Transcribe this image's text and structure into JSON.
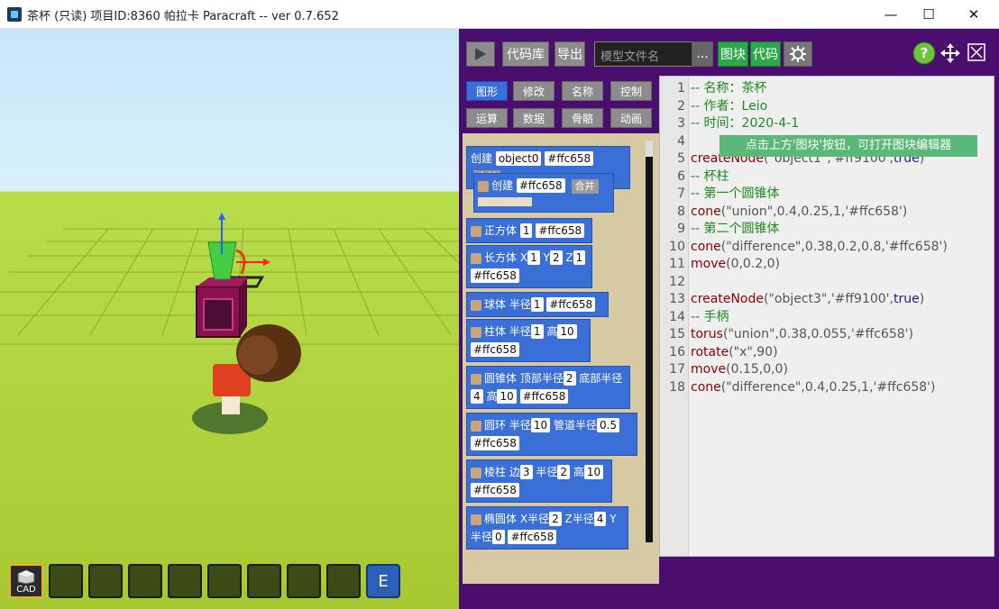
{
  "window": {
    "title": "茶杯 (只读) 项目ID:8360 帕拉卡 Paracraft -- ver 0.7.652",
    "minimize_glyph": "—",
    "maximize_glyph": "☐",
    "close_glyph": "✕"
  },
  "viewport": {
    "hotbar_active_label": "CAD",
    "hotbar_key": "E"
  },
  "toolbar": {
    "code_library_label": "代码库",
    "export_label": "导出",
    "filename_placeholder": "模型文件名",
    "filename_button": "...",
    "blocks_tab_label": "图块",
    "code_tab_label": "代码"
  },
  "categories": [
    {
      "label": "图形",
      "selected": true
    },
    {
      "label": "修改",
      "selected": false
    },
    {
      "label": "名称",
      "selected": false
    },
    {
      "label": "控制",
      "selected": false
    },
    {
      "label": "运算",
      "selected": false
    },
    {
      "label": "数据",
      "selected": false
    },
    {
      "label": "骨骼",
      "selected": false
    },
    {
      "label": "动画",
      "selected": false
    }
  ],
  "blocks": {
    "create": {
      "label": "创建",
      "name": "object0",
      "color": "#ffc658",
      "merge": "合并"
    },
    "sub_create": {
      "label": "创建",
      "color": "#ffc658",
      "merge": "合并"
    },
    "cube": {
      "label": "正方体",
      "size": "1",
      "color": "#ffc658"
    },
    "box": {
      "label": "长方体",
      "x": "X",
      "xv": "1",
      "y": "Y",
      "yv": "2",
      "z": "Z",
      "zv": "1",
      "color": "#ffc658"
    },
    "sphere": {
      "label": "球体",
      "r": "半径",
      "rv": "1",
      "color": "#ffc658"
    },
    "cylinder": {
      "label": "柱体",
      "r": "半径",
      "rv": "1",
      "h": "高",
      "hv": "10",
      "color": "#ffc658"
    },
    "cone": {
      "label": "圆锥体",
      "top": "顶部半径",
      "topv": "2",
      "bottom": "底部半径",
      "bottomv": "4",
      "h": "高",
      "hv": "10",
      "color": "#ffc658"
    },
    "torus": {
      "label": "圆环",
      "r": "半径",
      "rv": "10",
      "tube": "管道半径",
      "tubev": "0.5",
      "color": "#ffc658"
    },
    "prism": {
      "label": "棱柱",
      "edges": "边",
      "edgesv": "3",
      "r": "半径",
      "rv": "2",
      "h": "高",
      "hv": "10",
      "color": "#ffc658"
    },
    "ellipsoid": {
      "label": "椭圆体",
      "xr": "X半径",
      "xrv": "2",
      "zr": "Z半径",
      "zrv": "4",
      "y": "Y",
      "yr": "半径",
      "yrv": "0",
      "color": "#ffc658"
    }
  },
  "editor": {
    "tooltip": "点击上方'图块'按钮，可打开图块编辑器",
    "lines": [
      {
        "n": "1",
        "text": "-- 名称：茶杯"
      },
      {
        "n": "2",
        "text": "-- 作者：Leio"
      },
      {
        "n": "3",
        "text": "-- 时间：2020-4-1"
      },
      {
        "n": "4",
        "text": ""
      },
      {
        "n": "5",
        "fn": "createNode",
        "args": "(\"object1\",'#ff9100',",
        "kw": "true",
        "tail": ")"
      },
      {
        "n": "6",
        "text": "-- 杯柱"
      },
      {
        "n": "7",
        "text": "-- 第一个圆锥体"
      },
      {
        "n": "8",
        "fn": "cone",
        "args": "(\"union\",0.4,0.25,1,'#ffc658')"
      },
      {
        "n": "9",
        "text": "-- 第二个圆锥体"
      },
      {
        "n": "10",
        "fn": "cone",
        "args": "(\"difference\",0.38,0.2,0.8,'#ffc658')"
      },
      {
        "n": "11",
        "fn": "move",
        "args": "(0,0.2,0)"
      },
      {
        "n": "12",
        "text": ""
      },
      {
        "n": "13",
        "fn": "createNode",
        "args": "(\"object3\",'#ff9100',",
        "kw": "true",
        "tail": ")"
      },
      {
        "n": "14",
        "text": "-- 手柄"
      },
      {
        "n": "15",
        "fn": "torus",
        "args": "(\"union\",0.38,0.055,'#ffc658')"
      },
      {
        "n": "16",
        "fn": "rotate",
        "args": "(\"x\",90)"
      },
      {
        "n": "17",
        "fn": "move",
        "args": "(0.15,0,0)"
      },
      {
        "n": "18",
        "fn": "cone",
        "args": "(\"difference\",0.4,0.25,1,'#ffc658')"
      }
    ]
  }
}
